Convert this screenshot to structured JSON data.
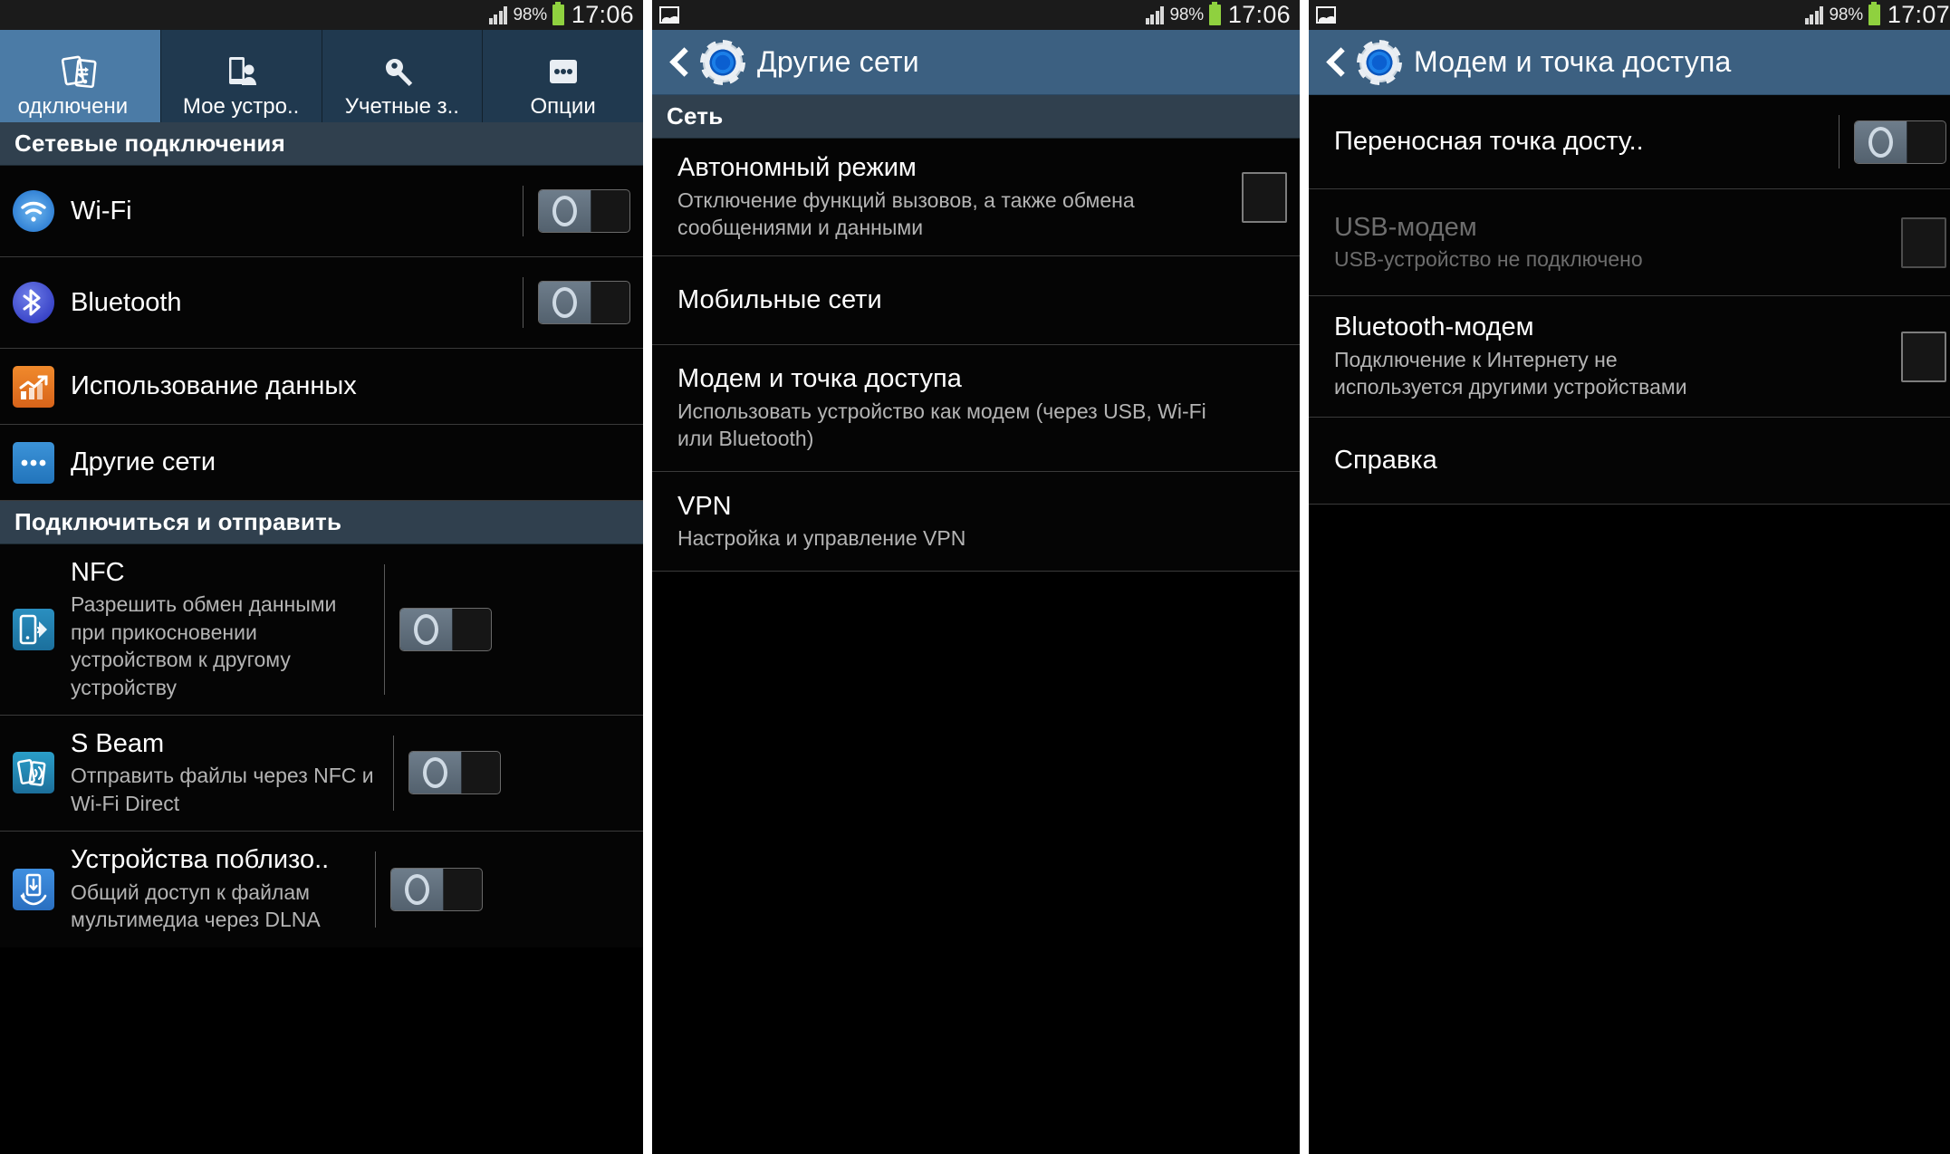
{
  "statusbar": {
    "battery_percent": "98%",
    "clock_p1": "17:06",
    "clock_p2": "17:06",
    "clock_p3": "17:07",
    "notification_icon": "photo-icon",
    "signal_icon": "signal-bars-icon",
    "battery_icon": "battery-icon"
  },
  "panel1": {
    "tabs": [
      {
        "label": "одключени",
        "icon": "connections-icon",
        "active": true
      },
      {
        "label": "Мое устро..",
        "icon": "my-device-icon",
        "active": false
      },
      {
        "label": "Учетные з..",
        "icon": "accounts-key-icon",
        "active": false
      },
      {
        "label": "Опции",
        "icon": "more-options-icon",
        "active": false
      }
    ],
    "sections": [
      {
        "header": "Сетевые подключения",
        "rows": [
          {
            "title": "Wi-Fi",
            "sub": "",
            "icon": "wifi-icon",
            "control": "switch",
            "state": "off"
          },
          {
            "title": "Bluetooth",
            "sub": "",
            "icon": "bluetooth-icon",
            "control": "switch",
            "state": "off"
          },
          {
            "title": "Использование данных",
            "sub": "",
            "icon": "data-usage-icon",
            "control": "none"
          },
          {
            "title": "Другие сети",
            "sub": "",
            "icon": "other-networks-icon",
            "control": "none"
          }
        ]
      },
      {
        "header": "Подключиться и отправить",
        "rows": [
          {
            "title": "NFC",
            "sub": "Разрешить обмен данными при прикосновении устройством к другому устройству",
            "icon": "nfc-icon",
            "control": "switch",
            "state": "off"
          },
          {
            "title": "S Beam",
            "sub": "Отправить файлы через NFC и Wi-Fi Direct",
            "icon": "s-beam-icon",
            "control": "switch",
            "state": "off"
          },
          {
            "title": "Устройства поблизо..",
            "sub": "Общий доступ к файлам мультимедиа через DLNA",
            "icon": "nearby-devices-icon",
            "control": "switch",
            "state": "off"
          }
        ]
      }
    ]
  },
  "panel2": {
    "title": "Другие сети",
    "back_icon": "back-chevron-icon",
    "app_icon": "settings-gear-icon",
    "section_header": "Сеть",
    "rows": [
      {
        "title": "Автономный режим",
        "sub": "Отключение функций вызовов, а также обмена сообщениями и данными",
        "control": "checkbox",
        "state": "unchecked"
      },
      {
        "title": "Мобильные сети",
        "sub": "",
        "control": "none"
      },
      {
        "title": "Модем и точка доступа",
        "sub": "Использовать устройство как модем (через USB, Wi-Fi или Bluetooth)",
        "control": "none"
      },
      {
        "title": "VPN",
        "sub": "Настройка и управление VPN",
        "control": "none"
      }
    ]
  },
  "panel3": {
    "title": "Модем и точка доступа",
    "back_icon": "back-chevron-icon",
    "app_icon": "settings-gear-icon",
    "rows": [
      {
        "title": "Переносная точка досту..",
        "sub": "",
        "control": "switch",
        "state": "off",
        "disabled": false
      },
      {
        "title": "USB-модем",
        "sub": "USB-устройство не подключено",
        "control": "checkbox",
        "state": "unchecked",
        "disabled": true
      },
      {
        "title": "Bluetooth-модем",
        "sub": "Подключение к Интернету не используется другими устройствами",
        "control": "checkbox",
        "state": "unchecked",
        "disabled": false
      },
      {
        "title": "Справка",
        "sub": "",
        "control": "none",
        "disabled": false
      }
    ]
  },
  "colors": {
    "accent_blue": "#3c6081",
    "active_tab": "#4b7ba6",
    "section_header": "#30404e",
    "battery_green": "#8fd13f",
    "list_bg": "#050505"
  }
}
